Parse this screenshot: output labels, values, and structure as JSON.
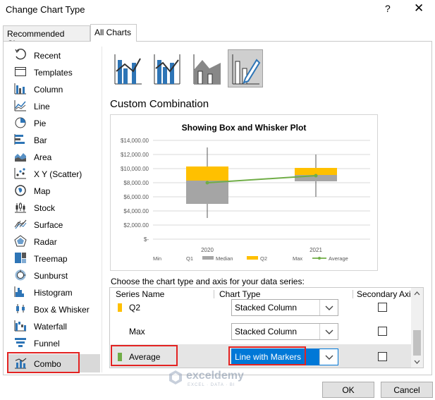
{
  "dialog": {
    "title": "Change Chart Type",
    "help_glyph": "?",
    "close_glyph": "✕"
  },
  "tabs": [
    {
      "label": "Recommended Charts",
      "active": false
    },
    {
      "label": "All Charts",
      "active": true
    }
  ],
  "chart_types": [
    {
      "label": "Recent",
      "icon": "recent-icon"
    },
    {
      "label": "Templates",
      "icon": "templates-icon"
    },
    {
      "label": "Column",
      "icon": "column-chart-icon"
    },
    {
      "label": "Line",
      "icon": "line-chart-icon"
    },
    {
      "label": "Pie",
      "icon": "pie-chart-icon"
    },
    {
      "label": "Bar",
      "icon": "bar-chart-icon"
    },
    {
      "label": "Area",
      "icon": "area-chart-icon"
    },
    {
      "label": "X Y (Scatter)",
      "icon": "scatter-chart-icon"
    },
    {
      "label": "Map",
      "icon": "map-chart-icon"
    },
    {
      "label": "Stock",
      "icon": "stock-chart-icon"
    },
    {
      "label": "Surface",
      "icon": "surface-chart-icon"
    },
    {
      "label": "Radar",
      "icon": "radar-chart-icon"
    },
    {
      "label": "Treemap",
      "icon": "treemap-chart-icon"
    },
    {
      "label": "Sunburst",
      "icon": "sunburst-chart-icon"
    },
    {
      "label": "Histogram",
      "icon": "histogram-chart-icon"
    },
    {
      "label": "Box & Whisker",
      "icon": "box-whisker-chart-icon"
    },
    {
      "label": "Waterfall",
      "icon": "waterfall-chart-icon"
    },
    {
      "label": "Funnel",
      "icon": "funnel-chart-icon"
    },
    {
      "label": "Combo",
      "icon": "combo-chart-icon",
      "selected": true
    }
  ],
  "combo_subtypes": [
    {
      "icon": "clustered-column-line-icon"
    },
    {
      "icon": "clustered-column-line-secondary-axis-icon"
    },
    {
      "icon": "stacked-area-clustered-column-icon"
    },
    {
      "icon": "custom-combination-icon",
      "selected": true
    }
  ],
  "section_heading": "Custom Combination",
  "preview_chart": {
    "title": "Showing Box and Whisker Plot",
    "y_ticks": [
      "$14,000.00",
      "$12,000.00",
      "$10,000.00",
      "$8,000.00",
      "$6,000.00",
      "$4,000.00",
      "$2,000.00",
      "$-"
    ],
    "categories": [
      "2020",
      "2021"
    ],
    "legend": [
      "Min",
      "Q1",
      "Median",
      "Q2",
      "Max",
      "Average"
    ]
  },
  "chart_data": {
    "type": "bar",
    "title": "Showing Box and Whisker Plot",
    "categories": [
      "2020",
      "2021"
    ],
    "ylim": [
      0,
      14000
    ],
    "y_ticks": [
      0,
      2000,
      4000,
      6000,
      8000,
      10000,
      12000,
      14000
    ],
    "series": [
      {
        "name": "Min",
        "kind": "stacked-column-invisible",
        "values": [
          5000,
          8200
        ]
      },
      {
        "name": "Q1",
        "kind": "stacked-column-invisible",
        "values": [
          0,
          0
        ]
      },
      {
        "name": "Median",
        "kind": "stacked-column",
        "color": "#a5a5a5",
        "values": [
          3300,
          900
        ]
      },
      {
        "name": "Q2",
        "kind": "stacked-column",
        "color": "#ffc000",
        "values": [
          2000,
          1000
        ]
      },
      {
        "name": "Max",
        "kind": "stacked-column-invisible",
        "values": [
          0,
          0
        ]
      },
      {
        "name": "Average",
        "kind": "line-with-markers",
        "color": "#70ad47",
        "values": [
          8000,
          9000
        ]
      }
    ],
    "whiskers": [
      {
        "category": "2020",
        "low": 3000,
        "high": 13000
      },
      {
        "category": "2021",
        "low": 6000,
        "high": 12000
      }
    ],
    "grid": true,
    "legend_position": "bottom"
  },
  "series_prompt": "Choose the chart type and axis for your data series:",
  "series_table": {
    "headers": [
      "Series Name",
      "Chart Type",
      "Secondary Axis"
    ],
    "rows": [
      {
        "name": "Q2",
        "swatch": "#ffc000",
        "chart_type": "Stacked Column",
        "secondary": false
      },
      {
        "name": "Max",
        "swatch": "",
        "chart_type": "Stacked Column",
        "secondary": false
      },
      {
        "name": "Average",
        "swatch": "#70ad47",
        "chart_type": "Line with Markers",
        "secondary": false,
        "selected": true
      }
    ]
  },
  "watermark": {
    "name": "exceldemy",
    "tagline": "EXCEL · DATA · BI"
  },
  "buttons": {
    "ok": "OK",
    "cancel": "Cancel"
  },
  "colors": {
    "highlight_red": "#e32322",
    "accent_blue": "#0078d7",
    "q2_yellow": "#ffc000",
    "median_gray": "#a5a5a5",
    "average_green": "#70ad47"
  }
}
